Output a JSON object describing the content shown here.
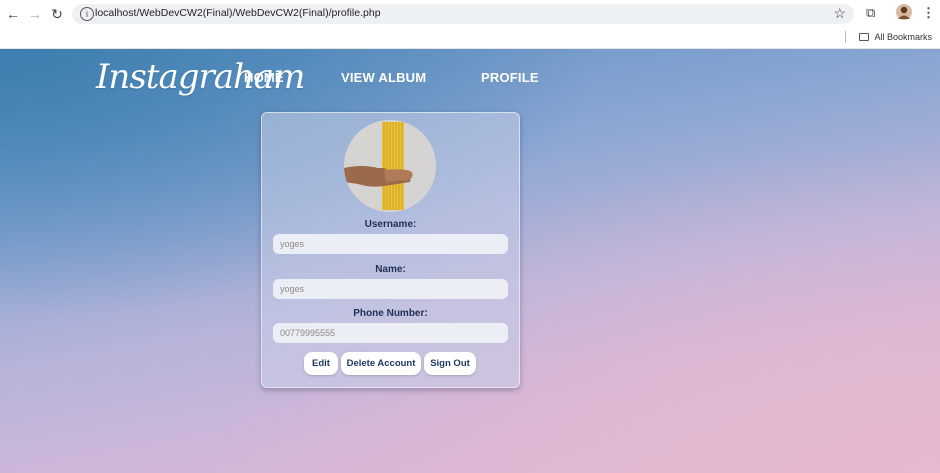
{
  "browser": {
    "url": "localhost/WebDevCW2(Final)/WebDevCW2(Final)/profile.php",
    "bookmarks_label": "All Bookmarks"
  },
  "site": {
    "logo": "Instagraham",
    "nav": [
      "HOME",
      "VIEW ALBUM",
      "PROFILE"
    ]
  },
  "profile": {
    "username_label": "Username:",
    "username_value": "yoges",
    "name_label": "Name:",
    "name_value": "yoges",
    "phone_label": "Phone Number:",
    "phone_value": "00779995555",
    "buttons": [
      "Edit",
      "Delete Account",
      "Sign Out"
    ]
  },
  "colors": {
    "accent_text": "#1f2f55",
    "button_text": "#203a63"
  }
}
